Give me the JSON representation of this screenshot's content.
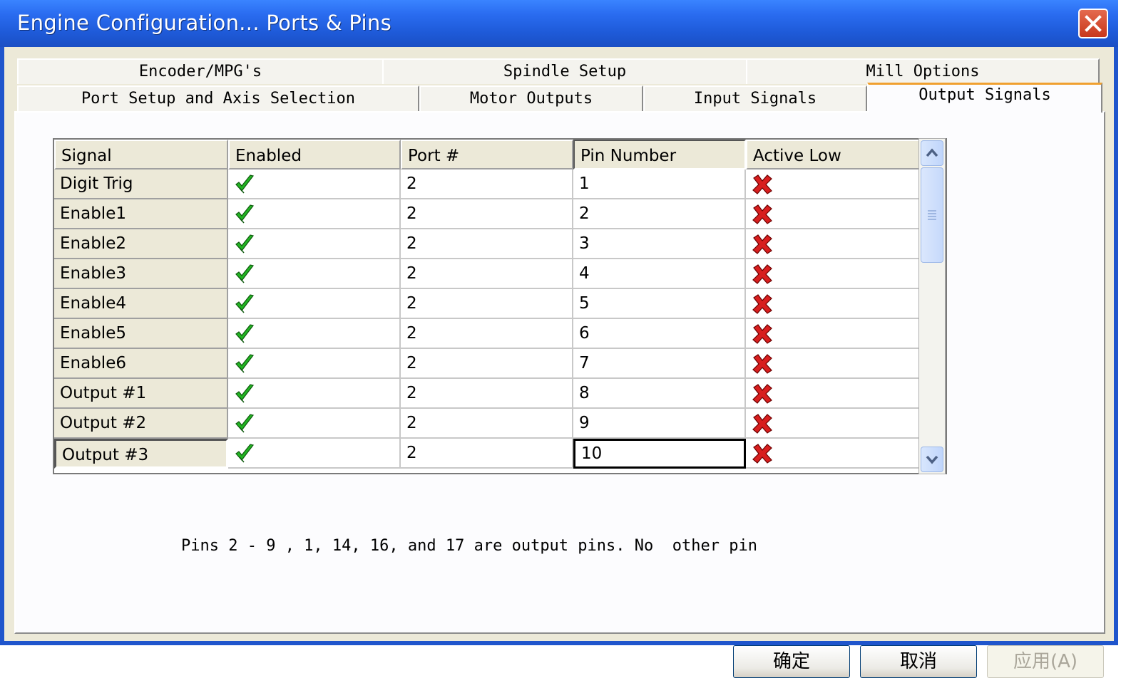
{
  "window": {
    "title": "Engine Configuration... Ports & Pins"
  },
  "tabs_row1": [
    {
      "label": "Encoder/MPG's"
    },
    {
      "label": "Spindle Setup"
    },
    {
      "label": "Mill Options"
    }
  ],
  "tabs_row2": [
    {
      "label": "Port Setup and Axis Selection"
    },
    {
      "label": "Motor Outputs"
    },
    {
      "label": "Input Signals"
    },
    {
      "label": "Output Signals",
      "active": true
    }
  ],
  "grid": {
    "columns": [
      "Signal",
      "Enabled",
      "Port #",
      "Pin Number",
      "Active Low"
    ],
    "rows": [
      {
        "signal": "Digit Trig",
        "enabled": true,
        "port": "2",
        "pin": "1",
        "active_low": false
      },
      {
        "signal": "Enable1",
        "enabled": true,
        "port": "2",
        "pin": "2",
        "active_low": false
      },
      {
        "signal": "Enable2",
        "enabled": true,
        "port": "2",
        "pin": "3",
        "active_low": false
      },
      {
        "signal": "Enable3",
        "enabled": true,
        "port": "2",
        "pin": "4",
        "active_low": false
      },
      {
        "signal": "Enable4",
        "enabled": true,
        "port": "2",
        "pin": "5",
        "active_low": false
      },
      {
        "signal": "Enable5",
        "enabled": true,
        "port": "2",
        "pin": "6",
        "active_low": false
      },
      {
        "signal": "Enable6",
        "enabled": true,
        "port": "2",
        "pin": "7",
        "active_low": false
      },
      {
        "signal": "Output #1",
        "enabled": true,
        "port": "2",
        "pin": "8",
        "active_low": false
      },
      {
        "signal": "Output #2",
        "enabled": true,
        "port": "2",
        "pin": "9",
        "active_low": false
      },
      {
        "signal": "Output #3",
        "enabled": true,
        "port": "2",
        "pin": "10",
        "active_low": false
      }
    ],
    "icons": {
      "enabled": "green-check-icon",
      "disabled": "red-x-icon"
    },
    "colors": {
      "check": "#22b422",
      "cross": "#d81e1e"
    }
  },
  "note": "Pins 2 - 9 , 1, 14, 16, and 17 are output pins. No  other pin",
  "buttons": {
    "ok": "确定",
    "cancel": "取消",
    "apply": "应用(A)"
  }
}
